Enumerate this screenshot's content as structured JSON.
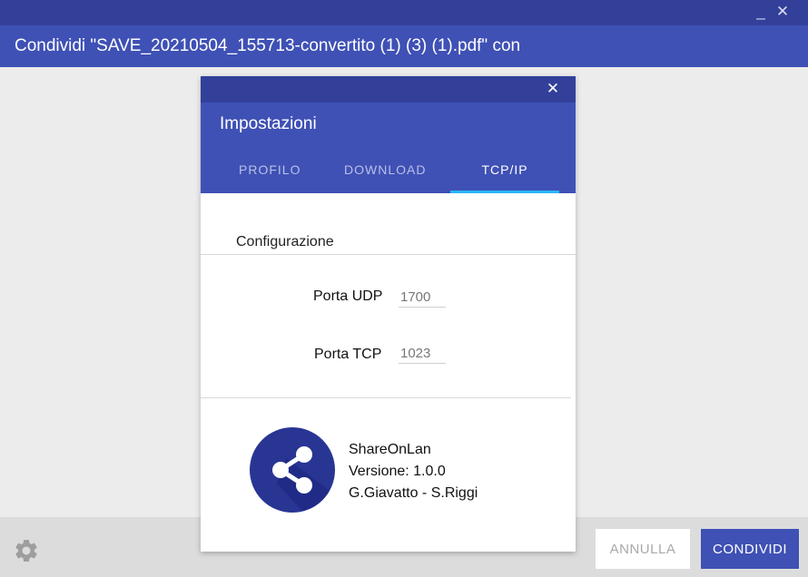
{
  "window": {
    "title": "Condividi \"SAVE_20210504_155713-convertito (1) (3) (1).pdf\" con",
    "minimize_glyph": "_",
    "close_glyph": "✕"
  },
  "footer": {
    "settings_icon": "gear-icon",
    "cancel_label": "ANNULLA",
    "share_label": "CONDIVIDI"
  },
  "dialog": {
    "close_glyph": "✕",
    "title": "Impostazioni",
    "tabs": [
      {
        "label": "PROFILO",
        "active": false
      },
      {
        "label": "DOWNLOAD",
        "active": false
      },
      {
        "label": "TCP/IP",
        "active": true
      }
    ],
    "section_label": "Configurazione",
    "udp": {
      "label": "Porta UDP",
      "value": "1700"
    },
    "tcp": {
      "label": "Porta TCP",
      "value": "1023"
    },
    "about": {
      "icon": "share-icon",
      "name": "ShareOnLan",
      "version": "Versione: 1.0.0",
      "authors": "G.Giavatto - S.Riggi"
    }
  },
  "colors": {
    "primary": "#3f51b5",
    "primary_dark": "#33409a",
    "tab_indicator": "#29b6f6",
    "icon_bg": "#283593"
  }
}
